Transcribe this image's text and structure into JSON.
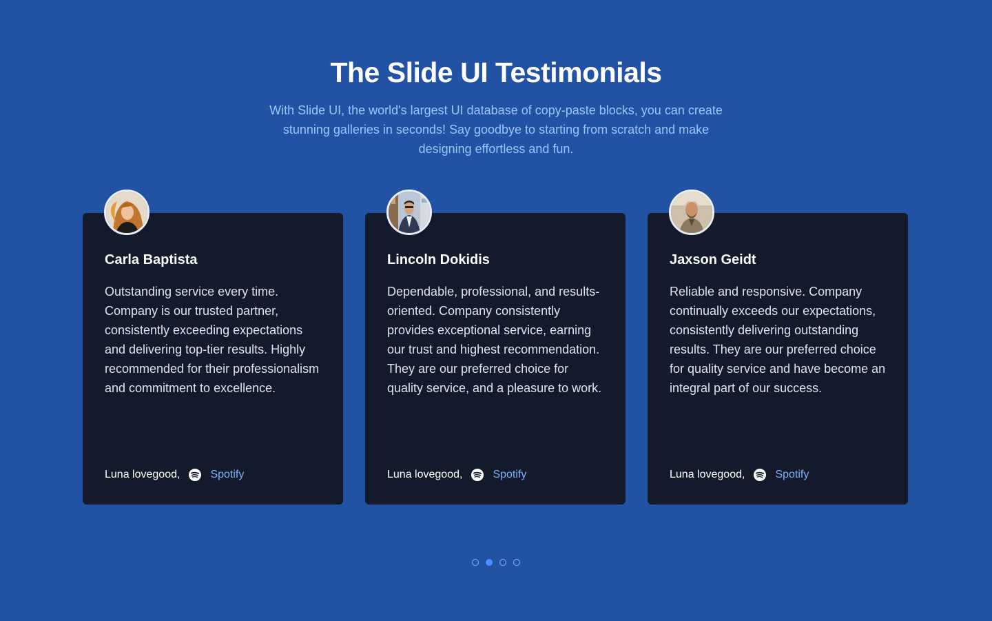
{
  "header": {
    "title": "The Slide UI Testimonials",
    "subtitle": "With Slide UI, the world's largest UI database of copy-paste blocks, you can create stunning galleries in seconds! Say goodbye to starting from scratch and make designing effortless and fun."
  },
  "testimonials": [
    {
      "name": "Carla Baptista",
      "quote": "Outstanding service every time. Company is our trusted partner, consistently exceeding expectations and delivering top-tier results. Highly recommended for their professionalism and commitment to excellence.",
      "author": "Luna lovegood,",
      "company": "Spotify",
      "company_icon": "spotify-icon"
    },
    {
      "name": "Lincoln Dokidis",
      "quote": "Dependable, professional, and results-oriented. Company consistently provides exceptional service, earning our trust and highest recommendation. They are our preferred choice for quality service, and a pleasure to work.",
      "author": "Luna lovegood,",
      "company": "Spotify",
      "company_icon": "spotify-icon"
    },
    {
      "name": "Jaxson Geidt",
      "quote": "Reliable and responsive. Company continually exceeds our expectations, consistently delivering outstanding results. They are our preferred choice for quality service and have become an integral part of our success.",
      "author": "Luna lovegood,",
      "company": "Spotify",
      "company_icon": "spotify-icon"
    }
  ],
  "pagination": {
    "total": 4,
    "active_index": 1
  },
  "colors": {
    "background": "#2252a3",
    "card": "#121a2b",
    "accent": "#7db2ff",
    "subtitle": "#9cc4ff"
  }
}
